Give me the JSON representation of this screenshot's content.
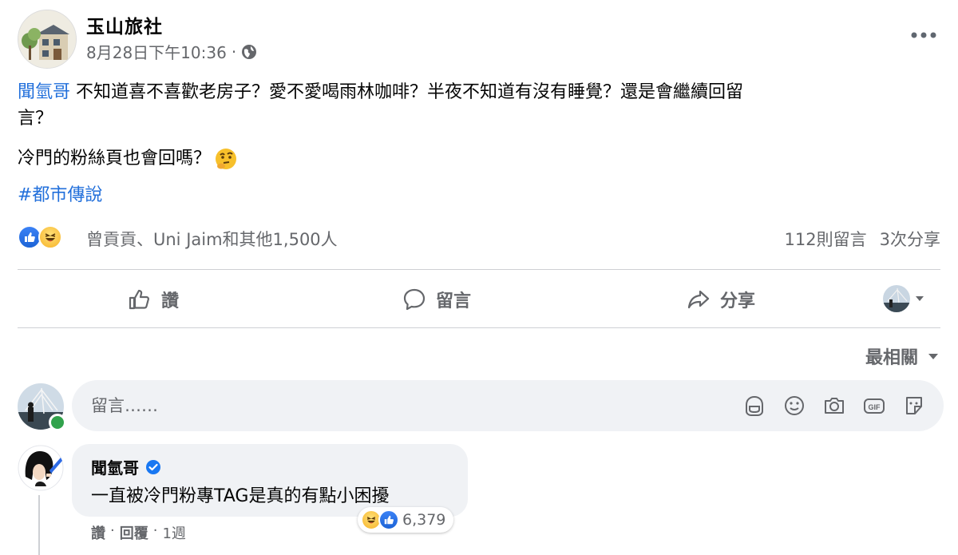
{
  "post": {
    "page_name": "玉山旅社",
    "timestamp": "8月28日下午10:36",
    "separator": "·",
    "privacy_icon": "globe-icon",
    "more_icon": "ellipsis-icon",
    "line1_mention": "聞氫哥",
    "line1_text": " 不知道喜不喜歡老房子？愛不愛喝雨林咖啡？半夜不知道有沒有睡覺？還是會繼續回留",
    "line1_cont": "言？",
    "line2_text": "冷門的粉絲頁也會回嗎？",
    "line2_emoji": "thinking-face-emoji",
    "hashtag": "#都市傳說"
  },
  "reactions": {
    "icons": [
      "like-icon",
      "haha-icon"
    ],
    "summary": "曾貢貢、Uni Jaim和其他1,500人",
    "comments_count": "112則留言",
    "shares_count": "3次分享"
  },
  "actions": {
    "like": "讚",
    "comment": "留言",
    "share": "分享"
  },
  "sort": {
    "label": "最相關"
  },
  "composer": {
    "placeholder": "留言……",
    "tools": [
      "avatar-sticker-icon",
      "emoji-icon",
      "camera-icon",
      "gif-icon",
      "sticker-icon"
    ]
  },
  "comment": {
    "author": "聞氫哥",
    "verified": true,
    "text": "一直被冷門粉專TAG是真的有點小困擾",
    "reaction_count": "6,379",
    "like_label": "讚",
    "dot": "·",
    "reply_label": "回覆",
    "time": "1週"
  },
  "colors": {
    "link_blue": "#216fdb",
    "meta_gray": "#65676b",
    "bubble_bg": "#f0f2f5",
    "online_green": "#31a24c",
    "verified_blue": "#1877f2"
  }
}
